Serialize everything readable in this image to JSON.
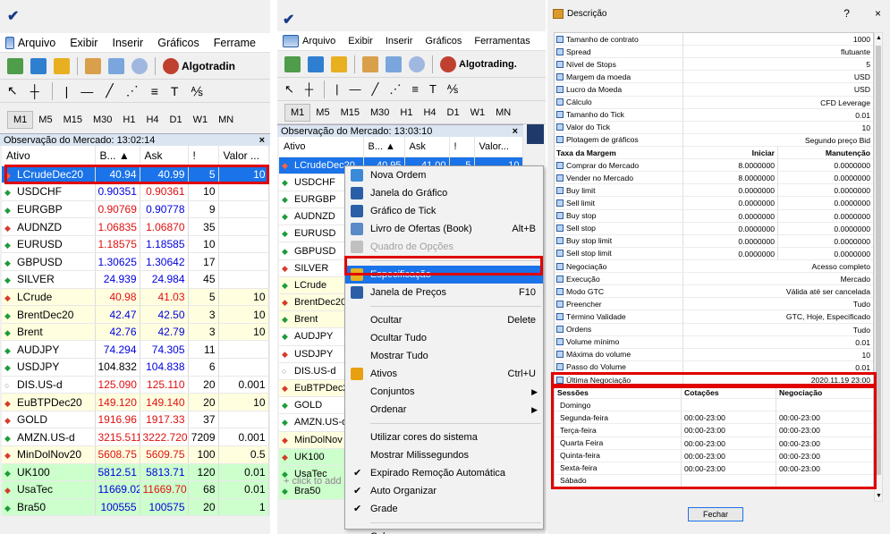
{
  "panel1": {
    "menu": [
      "Arquivo",
      "Exibir",
      "Inserir",
      "Gráficos",
      "Ferrame"
    ],
    "algotrading": "Algotradin",
    "timeframes": [
      "M1",
      "M5",
      "M15",
      "M30",
      "H1",
      "H4",
      "D1",
      "W1",
      "MN"
    ],
    "market_watch_title": "Observação do Mercado: 13:02:14",
    "close": "×",
    "headers": [
      "Ativo",
      "B... ▲",
      "Ask",
      "!",
      "Valor ..."
    ],
    "rows": [
      {
        "dir": "down",
        "symbol": "LCrudeDec20",
        "bid": "40.94",
        "ask": "40.99",
        "spread": "5",
        "value": "10",
        "bg": "sel",
        "bidc": "",
        "askc": ""
      },
      {
        "dir": "up",
        "symbol": "USDCHF",
        "bid": "0.90351",
        "ask": "0.90361",
        "spread": "10",
        "value": "",
        "bg": "white",
        "bidc": "up",
        "askc": "down"
      },
      {
        "dir": "up",
        "symbol": "EURGBP",
        "bid": "0.90769",
        "ask": "0.90778",
        "spread": "9",
        "value": "",
        "bg": "white",
        "bidc": "down",
        "askc": "up"
      },
      {
        "dir": "down",
        "symbol": "AUDNZD",
        "bid": "1.06835",
        "ask": "1.06870",
        "spread": "35",
        "value": "",
        "bg": "white",
        "bidc": "down",
        "askc": "down"
      },
      {
        "dir": "up",
        "symbol": "EURUSD",
        "bid": "1.18575",
        "ask": "1.18585",
        "spread": "10",
        "value": "",
        "bg": "white",
        "bidc": "down",
        "askc": "up"
      },
      {
        "dir": "up",
        "symbol": "GBPUSD",
        "bid": "1.30625",
        "ask": "1.30642",
        "spread": "17",
        "value": "",
        "bg": "white",
        "bidc": "up",
        "askc": "up"
      },
      {
        "dir": "up",
        "symbol": "SILVER",
        "bid": "24.939",
        "ask": "24.984",
        "spread": "45",
        "value": "",
        "bg": "white",
        "bidc": "up",
        "askc": "up"
      },
      {
        "dir": "down",
        "symbol": "LCrude",
        "bid": "40.98",
        "ask": "41.03",
        "spread": "5",
        "value": "10",
        "bg": "yellow",
        "bidc": "down",
        "askc": "down"
      },
      {
        "dir": "up",
        "symbol": "BrentDec20",
        "bid": "42.47",
        "ask": "42.50",
        "spread": "3",
        "value": "10",
        "bg": "yellow",
        "bidc": "up",
        "askc": "up"
      },
      {
        "dir": "up",
        "symbol": "Brent",
        "bid": "42.76",
        "ask": "42.79",
        "spread": "3",
        "value": "10",
        "bg": "yellow",
        "bidc": "up",
        "askc": "up"
      },
      {
        "dir": "up",
        "symbol": "AUDJPY",
        "bid": "74.294",
        "ask": "74.305",
        "spread": "11",
        "value": "",
        "bg": "white",
        "bidc": "up",
        "askc": "up"
      },
      {
        "dir": "up",
        "symbol": "USDJPY",
        "bid": "104.832",
        "ask": "104.838",
        "spread": "6",
        "value": "",
        "bg": "white",
        "bidc": "",
        "askc": "up"
      },
      {
        "dir": "neu",
        "symbol": "DIS.US-d",
        "bid": "125.090",
        "ask": "125.110",
        "spread": "20",
        "value": "0.001",
        "bg": "white",
        "bidc": "down",
        "askc": "down"
      },
      {
        "dir": "down",
        "symbol": "EuBTPDec20",
        "bid": "149.120",
        "ask": "149.140",
        "spread": "20",
        "value": "10",
        "bg": "yellow",
        "bidc": "down",
        "askc": "down"
      },
      {
        "dir": "down",
        "symbol": "GOLD",
        "bid": "1916.96",
        "ask": "1917.33",
        "spread": "37",
        "value": "",
        "bg": "white",
        "bidc": "down",
        "askc": "down"
      },
      {
        "dir": "up",
        "symbol": "AMZN.US-d",
        "bid": "3215.511",
        "ask": "3222.720",
        "spread": "7209",
        "value": "0.001",
        "bg": "white",
        "bidc": "down",
        "askc": "down"
      },
      {
        "dir": "down",
        "symbol": "MinDolNov20",
        "bid": "5608.75",
        "ask": "5609.75",
        "spread": "100",
        "value": "0.5",
        "bg": "yellow",
        "bidc": "down",
        "askc": "down"
      },
      {
        "dir": "up",
        "symbol": "UK100",
        "bid": "5812.51",
        "ask": "5813.71",
        "spread": "120",
        "value": "0.01",
        "bg": "green",
        "bidc": "up",
        "askc": "up"
      },
      {
        "dir": "down",
        "symbol": "UsaTec",
        "bid": "11669.02",
        "ask": "11669.70",
        "spread": "68",
        "value": "0.01",
        "bg": "green",
        "bidc": "up",
        "askc": "down"
      },
      {
        "dir": "up",
        "symbol": "Bra50",
        "bid": "100555",
        "ask": "100575",
        "spread": "20",
        "value": "1",
        "bg": "green",
        "bidc": "up",
        "askc": "up"
      }
    ]
  },
  "panel2": {
    "menu": [
      "Arquivo",
      "Exibir",
      "Inserir",
      "Gráficos",
      "Ferramentas"
    ],
    "algotrading": "Algotrading.",
    "timeframes": [
      "M1",
      "M5",
      "M15",
      "M30",
      "H1",
      "H4",
      "D1",
      "W1",
      "MN"
    ],
    "market_watch_title": "Observação do Mercado: 13:03:10",
    "close": "×",
    "headers": [
      "Ativo",
      "B... ▲",
      "Ask",
      "!",
      "Valor..."
    ],
    "rows": [
      {
        "dir": "down",
        "symbol": "LCrudeDec20",
        "bid": "40.95",
        "ask": "41.00",
        "spread": "5",
        "value": "10",
        "bg": "sel"
      },
      {
        "dir": "up",
        "symbol": "USDCHF",
        "bg": "white"
      },
      {
        "dir": "up",
        "symbol": "EURGBP",
        "bg": "white"
      },
      {
        "dir": "up",
        "symbol": "AUDNZD",
        "bg": "white"
      },
      {
        "dir": "up",
        "symbol": "EURUSD",
        "bg": "white"
      },
      {
        "dir": "up",
        "symbol": "GBPUSD",
        "bg": "white"
      },
      {
        "dir": "down",
        "symbol": "SILVER",
        "bg": "white"
      },
      {
        "dir": "up",
        "symbol": "LCrude",
        "bg": "yellow"
      },
      {
        "dir": "down",
        "symbol": "BrentDec20",
        "bg": "yellow"
      },
      {
        "dir": "up",
        "symbol": "Brent",
        "bg": "yellow"
      },
      {
        "dir": "up",
        "symbol": "AUDJPY",
        "bg": "white"
      },
      {
        "dir": "down",
        "symbol": "USDJPY",
        "bg": "white"
      },
      {
        "dir": "neu",
        "symbol": "DIS.US-d",
        "bg": "white"
      },
      {
        "dir": "down",
        "symbol": "EuBTPDec20",
        "bg": "yellow"
      },
      {
        "dir": "up",
        "symbol": "GOLD",
        "bg": "white"
      },
      {
        "dir": "up",
        "symbol": "AMZN.US-d",
        "bg": "white"
      },
      {
        "dir": "down",
        "symbol": "MinDolNov",
        "bg": "yellow"
      },
      {
        "dir": "down",
        "symbol": "UK100",
        "bg": "green"
      },
      {
        "dir": "up",
        "symbol": "UsaTec",
        "bg": "green"
      },
      {
        "dir": "up",
        "symbol": "Bra50",
        "bg": "green"
      }
    ],
    "add_symbol": "+ click to add",
    "context_menu": [
      {
        "label": "Nova Ordem",
        "icon": "new-order-icon",
        "color": "#3a8ad6"
      },
      {
        "label": "Janela do Gráfico",
        "icon": "chart-window-icon",
        "color": "#2a5fa8"
      },
      {
        "label": "Gráfico de Tick",
        "icon": "tick-chart-icon",
        "color": "#2a5fa8"
      },
      {
        "label": "Livro de Ofertas (Book)",
        "icon": "order-book-icon",
        "color": "#5a8ac8",
        "shortcut": "Alt+B"
      },
      {
        "label": "Quadro de Opções",
        "icon": "options-board-icon",
        "color": "#c0c0c0",
        "disabled": true
      },
      {
        "sep": true
      },
      {
        "label": "Especificação",
        "icon": "specification-icon",
        "color": "#e8b020",
        "highlight": true
      },
      {
        "label": "Janela de Preços",
        "icon": "price-window-icon",
        "color": "#2a5fa8",
        "shortcut": "F10"
      },
      {
        "sep": true
      },
      {
        "label": "Ocultar",
        "shortcut": "Delete"
      },
      {
        "label": "Ocultar Tudo"
      },
      {
        "label": "Mostrar Tudo"
      },
      {
        "label": "Ativos",
        "icon": "symbols-icon",
        "color": "#e8a010",
        "shortcut": "Ctrl+U"
      },
      {
        "label": "Conjuntos",
        "submenu": true
      },
      {
        "label": "Ordenar",
        "submenu": true
      },
      {
        "sep": true
      },
      {
        "label": "Utilizar cores do sistema"
      },
      {
        "label": "Mostrar Milissegundos"
      },
      {
        "label": "Expirado Remoção Automática",
        "checked": true
      },
      {
        "label": "Auto Organizar",
        "checked": true
      },
      {
        "label": "Grade",
        "checked": true
      },
      {
        "sep": true
      },
      {
        "label": "Colunas",
        "submenu": true
      }
    ]
  },
  "panel3": {
    "title": "Descrição",
    "help": "?",
    "close": "×",
    "properties": [
      {
        "k": "Tamanho de contrato",
        "v": "1000"
      },
      {
        "k": "Spread",
        "v": "flutuante"
      },
      {
        "k": "Nível de Stops",
        "v": "5"
      },
      {
        "k": "Margem da moeda",
        "v": "USD"
      },
      {
        "k": "Lucro da Moeda",
        "v": "USD"
      },
      {
        "k": "Cálculo",
        "v": "CFD Leverage"
      },
      {
        "k": "Tamanho do Tick",
        "v": "0.01"
      },
      {
        "k": "Valor do Tick",
        "v": "10"
      },
      {
        "k": "Plotagem de gráficos",
        "v": "Segundo preço Bid"
      }
    ],
    "margin_header": [
      "Taxa da Margem",
      "Iniciar",
      "Manutenção"
    ],
    "margins": [
      {
        "k": "Comprar do Mercado",
        "a": "8.0000000",
        "b": "0.0000000"
      },
      {
        "k": "Vender no Mercado",
        "a": "8.0000000",
        "b": "0.0000000"
      },
      {
        "k": "Buy limit",
        "a": "0.0000000",
        "b": "0.0000000"
      },
      {
        "k": "Sell limit",
        "a": "0.0000000",
        "b": "0.0000000"
      },
      {
        "k": "Buy stop",
        "a": "0.0000000",
        "b": "0.0000000"
      },
      {
        "k": "Sell stop",
        "a": "0.0000000",
        "b": "0.0000000"
      },
      {
        "k": "Buy stop limit",
        "a": "0.0000000",
        "b": "0.0000000"
      },
      {
        "k": "Sell stop limit",
        "a": "0.0000000",
        "b": "0.0000000"
      }
    ],
    "properties2": [
      {
        "k": "Negociação",
        "v": "Acesso completo"
      },
      {
        "k": "Execução",
        "v": "Mercado"
      },
      {
        "k": "Modo GTC",
        "v": "Válida até ser cancelada"
      },
      {
        "k": "Preencher",
        "v": "Tudo"
      },
      {
        "k": "Término Validade",
        "v": "GTC, Hoje, Especificado"
      },
      {
        "k": "Ordens",
        "v": "Tudo"
      },
      {
        "k": "Volume mínimo",
        "v": "0.01"
      },
      {
        "k": "Máxima do volume",
        "v": "10"
      },
      {
        "k": "Passo do Volume",
        "v": "0.01"
      },
      {
        "k": "Última Negociação",
        "v": "2020.11.19 23:00"
      }
    ],
    "session_header": [
      "Sessões",
      "Cotações",
      "Negociação"
    ],
    "sessions": [
      {
        "d": "Domingo",
        "q": "",
        "t": ""
      },
      {
        "d": "Segunda-feira",
        "q": "00:00-23:00",
        "t": "00:00-23:00"
      },
      {
        "d": "Terça-feira",
        "q": "00:00-23:00",
        "t": "00:00-23:00"
      },
      {
        "d": "Quarta Feira",
        "q": "00:00-23:00",
        "t": "00:00-23:00"
      },
      {
        "d": "Quinta-feira",
        "q": "00:00-23:00",
        "t": "00:00-23:00"
      },
      {
        "d": "Sexta-feira",
        "q": "00:00-23:00",
        "t": "00:00-23:00"
      },
      {
        "d": "Sábado",
        "q": "",
        "t": ""
      }
    ],
    "close_button": "Fechar"
  },
  "colors": {
    "highlight_box": "#e00000",
    "selection": "#1a73e8",
    "row_yellow": "#ffffe0",
    "row_green": "#ccffcc"
  }
}
